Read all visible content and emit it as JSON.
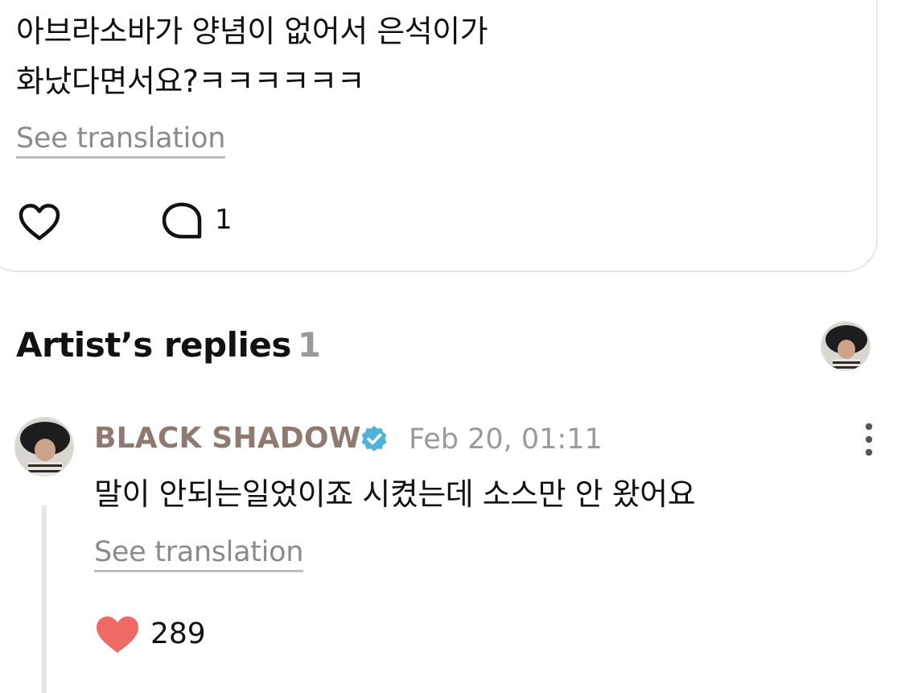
{
  "post": {
    "text_line1": "아브라소바가 양념이 없어서 은석이가",
    "text_line2": "화났다면서요?ㅋㅋㅋㅋㅋㅋ",
    "see_translation": "See translation",
    "comment_count": "1",
    "icons": {
      "like": "heart-outline-icon",
      "comment": "comment-bubble-icon"
    }
  },
  "section": {
    "title": "Artist’s replies",
    "count": "1"
  },
  "reply": {
    "author": "BLACK SHADOW",
    "timestamp": "Feb 20, 01:11",
    "text": "말이 안되는일었이죠 시켰는데 소스만 안 왔어요",
    "see_translation": "See translation",
    "like_count": "289",
    "icons": {
      "verified": "verified-badge-icon",
      "more": "more-vertical-icon",
      "like": "heart-filled-icon"
    }
  },
  "colors": {
    "author": "#8f7a72",
    "muted": "#9a9a9a",
    "heart": "#ef6a64",
    "verified": "#4fb3d9",
    "border": "#e6e6e6"
  }
}
